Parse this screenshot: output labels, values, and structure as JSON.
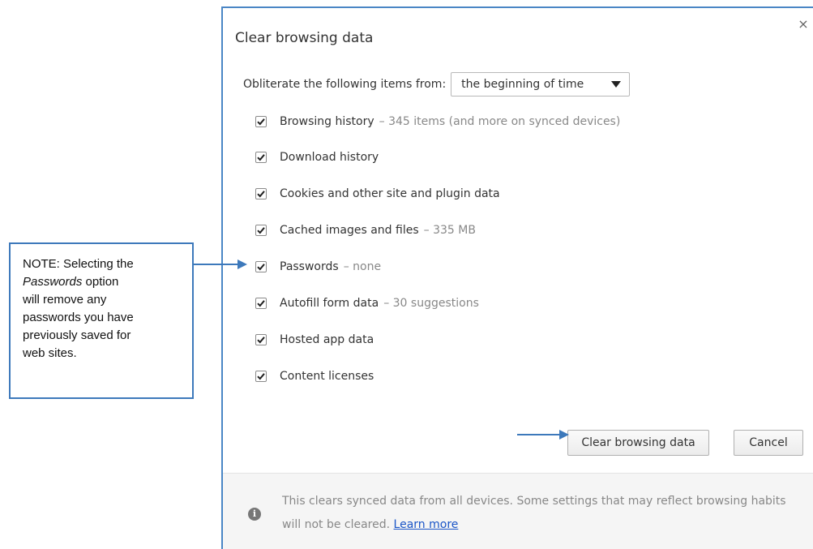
{
  "dialog": {
    "title": "Clear browsing data",
    "close_symbol": "×",
    "range_label": "Obliterate the following items from:",
    "range_selected": "the beginning of time",
    "options": [
      {
        "label": "Browsing history",
        "detail": "–  345 items (and more on synced devices)",
        "checked": true
      },
      {
        "label": "Download history",
        "detail": "",
        "checked": true
      },
      {
        "label": "Cookies and other site and plugin data",
        "detail": "",
        "checked": true
      },
      {
        "label": "Cached images and files",
        "detail": "–  335 MB",
        "checked": true
      },
      {
        "label": "Passwords",
        "detail": "–  none",
        "checked": true
      },
      {
        "label": "Autofill form data",
        "detail": "–  30 suggestions",
        "checked": true
      },
      {
        "label": "Hosted app data",
        "detail": "",
        "checked": true
      },
      {
        "label": "Content licenses",
        "detail": "",
        "checked": true
      }
    ],
    "clear_button": "Clear browsing data",
    "cancel_button": "Cancel",
    "footer": {
      "text": "This clears synced data from all devices. Some settings that may reflect browsing habits will not be cleared.",
      "link": "Learn more"
    }
  },
  "note": {
    "line1": "NOTE:  Selecting the",
    "line2_italic": "Passwords",
    "line2_rest": " option",
    "line3": "will remove any",
    "line4": "passwords you have",
    "line5": "previously saved for",
    "line6": "web sites."
  },
  "colors": {
    "accent": "#3d79bb",
    "link": "#1a55c7",
    "muted_text": "#888888"
  },
  "icons": {
    "close": "close-icon",
    "dropdown": "chevron-down-icon",
    "checkbox": "checkmark-icon",
    "info": "info-icon",
    "arrow": "arrow-right-icon"
  }
}
